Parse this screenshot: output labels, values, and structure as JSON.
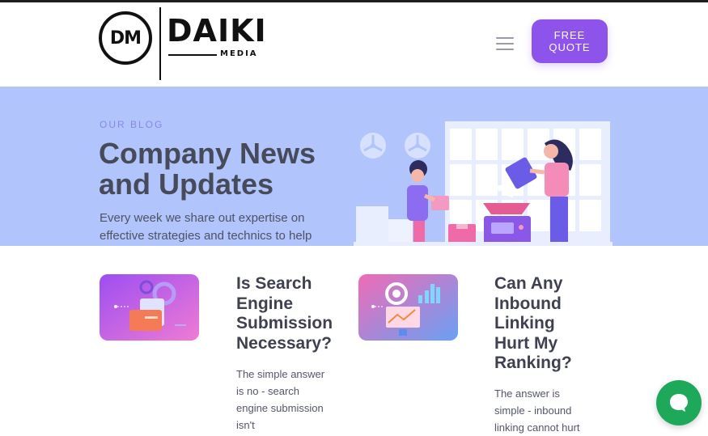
{
  "header": {
    "logo_mark": "DM",
    "logo_main": "DAIKI",
    "logo_sub": "MEDIA",
    "menu_icon": "hamburger-menu-icon",
    "quote_button": "FREE QUOTE"
  },
  "hero": {
    "eyebrow": "OUR BLOG",
    "title": "Company News and Updates",
    "description": "Every week we share out expertise on effective strategies and technics to help"
  },
  "posts": [
    {
      "title": "Is Search Engine Submission Necessary?",
      "excerpt": "The simple answer is no - search engine submission isn't"
    },
    {
      "title": "Can Any Inbound Linking Hurt My Ranking?",
      "excerpt": "The answer is simple - inbound linking cannot hurt"
    }
  ],
  "chat": {
    "icon": "chat-bubble-icon"
  },
  "colors": {
    "accent": "#8e53ea",
    "hero_bg": "#b1c4fb",
    "chat": "#1ea85a",
    "title_text": "#474a59"
  }
}
